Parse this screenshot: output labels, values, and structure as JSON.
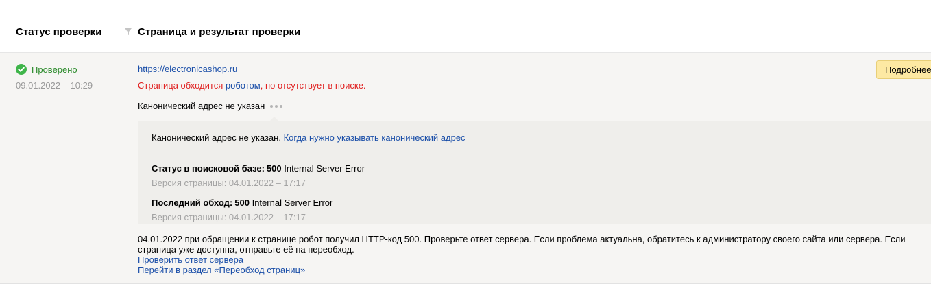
{
  "header": {
    "status_col": "Статус проверки",
    "page_col": "Страница и результат проверки",
    "filter_icon": "filter-icon"
  },
  "row": {
    "status": {
      "icon": "check-circle-icon",
      "label": "Проверено",
      "date": "09.01.2022 – 10:29",
      "color": "#2a8a2a"
    },
    "url": "https://electronicashop.ru",
    "warning": {
      "part1": "Страница обходится ",
      "link": "роботом",
      "part2": ", но отсутствует в поиске.",
      "color": "#e01f1f"
    },
    "canonical": "Канонический адрес не указан",
    "details": {
      "canonical_note": "Канонический адрес не указан.",
      "canonical_link": "Когда нужно указывать канонический адрес",
      "search_status_label": "Статус в поисковой базе:",
      "search_status_code": "500",
      "search_status_text": "Internal Server Error",
      "search_version": "Версия страницы: 04.01.2022 – 17:17",
      "last_crawl_label": "Последний обход:",
      "last_crawl_code": "500",
      "last_crawl_text": "Internal Server Error",
      "last_crawl_version": "Версия страницы: 04.01.2022 – 17:17"
    },
    "message": "04.01.2022 при обращении к странице робот получил HTTP-код 500. Проверьте ответ сервера. Если проблема актуальна, обратитесь к администратору своего сайта или сервера. Если страница уже доступна, отправьте её на переобход.",
    "links": {
      "check_server": "Проверить ответ сервера",
      "recrawl": "Перейти в раздел «Переобход страниц»"
    },
    "details_button": "Подробнее"
  },
  "colors": {
    "link": "#1a4ea8",
    "row_bg": "#f6f5f3",
    "button_bg": "#fde9a3"
  }
}
